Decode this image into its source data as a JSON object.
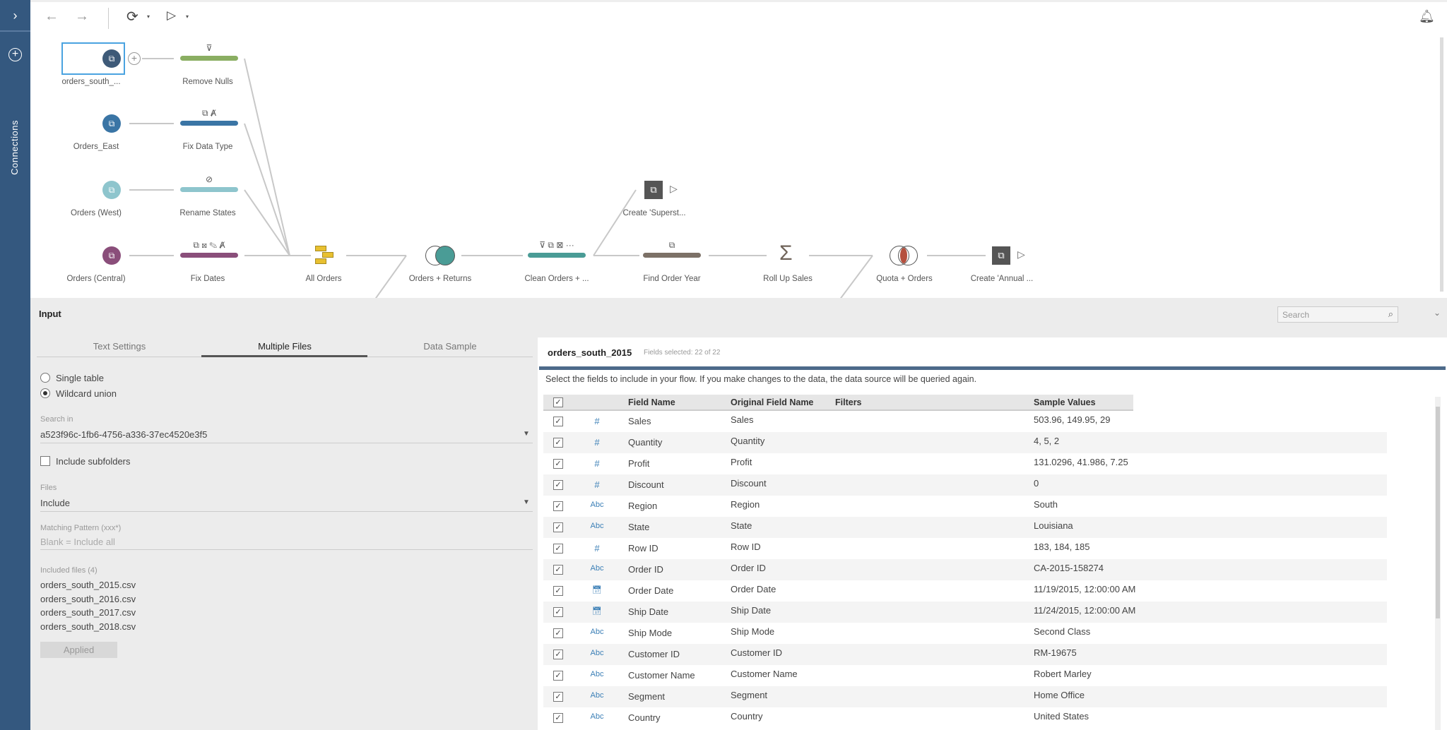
{
  "sidebar": {
    "label": "Connections"
  },
  "toolbar": {
    "back": "←",
    "forward": "→",
    "refresh": "⟳",
    "run": "▷"
  },
  "flow": {
    "inputs": [
      {
        "label": "orders_south_...",
        "color": "#3e5a78",
        "selected": true
      },
      {
        "label": "Orders_East",
        "color": "#3a75a5"
      },
      {
        "label": "Orders (West)",
        "color": "#8ec5cd"
      },
      {
        "label": "Orders (Central)",
        "color": "#8a4e7a"
      }
    ],
    "steps": [
      {
        "label": "Remove Nulls",
        "color": "#8aae62",
        "icons": "⊽"
      },
      {
        "label": "Fix Data Type",
        "color": "#3a75a5",
        "icons": "⧉ Ⱥ"
      },
      {
        "label": "Rename States",
        "color": "#8ec5cd",
        "icons": "⊘"
      },
      {
        "label": "Fix Dates",
        "color": "#8a4e7a",
        "icons": "⧉ ⊠ ✎ Ⱥ"
      }
    ],
    "union": {
      "label": "All Orders",
      "color": "#e8c030"
    },
    "join1": {
      "label": "Orders + Returns",
      "color": "#4a9c96"
    },
    "clean": {
      "label": "Clean Orders + ...",
      "color": "#4a9c96",
      "icons": "⊽ ⧉ ⊠ ···"
    },
    "output1": {
      "label": "Create 'Superst..."
    },
    "find": {
      "label": "Find Order Year",
      "color": "#7c7167",
      "icons": "⧉"
    },
    "agg": {
      "label": "Roll Up Sales",
      "symbol": "Σ"
    },
    "join2": {
      "label": "Quota + Orders",
      "color": "#b5503e"
    },
    "output2": {
      "label": "Create 'Annual ..."
    }
  },
  "panel": {
    "title": "Input",
    "search_placeholder": "Search",
    "tabs": [
      "Text Settings",
      "Multiple Files",
      "Data Sample"
    ],
    "active_tab": "Multiple Files",
    "radio": {
      "single": "Single table",
      "wildcard": "Wildcard union",
      "selected": "wildcard"
    },
    "search_in": {
      "label": "Search in",
      "value": "a523f96c-1fb6-4756-a336-37ec4520e3f5"
    },
    "subfolders": {
      "label": "Include subfolders",
      "checked": false
    },
    "files": {
      "label": "Files",
      "value": "Include"
    },
    "pattern": {
      "label": "Matching Pattern (xxx*)",
      "placeholder": "Blank = Include all"
    },
    "included": {
      "label": "Included files (4)",
      "files": [
        "orders_south_2015.csv",
        "orders_south_2016.csv",
        "orders_south_2017.csv",
        "orders_south_2018.csv"
      ]
    },
    "applied": "Applied"
  },
  "table": {
    "source": "orders_south_2015",
    "fields_selected": "Fields selected: 22 of 22",
    "instruction": "Select the fields to include in your flow. If you make changes to the data, the data source will be queried again.",
    "headers": [
      "Field Name",
      "Original Field Name",
      "Filters",
      "Sample Values"
    ],
    "rows": [
      {
        "type": "#",
        "name": "Sales",
        "orig": "Sales",
        "sample": "503.96, 149.95, 29"
      },
      {
        "type": "#",
        "name": "Quantity",
        "orig": "Quantity",
        "sample": "4, 5, 2"
      },
      {
        "type": "#",
        "name": "Profit",
        "orig": "Profit",
        "sample": "131.0296, 41.986, 7.25"
      },
      {
        "type": "#",
        "name": "Discount",
        "orig": "Discount",
        "sample": "0"
      },
      {
        "type": "Abc",
        "name": "Region",
        "orig": "Region",
        "sample": "South"
      },
      {
        "type": "Abc",
        "name": "State",
        "orig": "State",
        "sample": "Louisiana"
      },
      {
        "type": "#",
        "name": "Row ID",
        "orig": "Row ID",
        "sample": "183, 184, 185"
      },
      {
        "type": "Abc",
        "name": "Order ID",
        "orig": "Order ID",
        "sample": "CA-2015-158274"
      },
      {
        "type": "date",
        "name": "Order Date",
        "orig": "Order Date",
        "sample": "11/19/2015, 12:00:00 AM"
      },
      {
        "type": "date",
        "name": "Ship Date",
        "orig": "Ship Date",
        "sample": "11/24/2015, 12:00:00 AM"
      },
      {
        "type": "Abc",
        "name": "Ship Mode",
        "orig": "Ship Mode",
        "sample": "Second Class"
      },
      {
        "type": "Abc",
        "name": "Customer ID",
        "orig": "Customer ID",
        "sample": "RM-19675"
      },
      {
        "type": "Abc",
        "name": "Customer Name",
        "orig": "Customer Name",
        "sample": "Robert Marley"
      },
      {
        "type": "Abc",
        "name": "Segment",
        "orig": "Segment",
        "sample": "Home Office"
      },
      {
        "type": "Abc",
        "name": "Country",
        "orig": "Country",
        "sample": "United States"
      }
    ]
  }
}
